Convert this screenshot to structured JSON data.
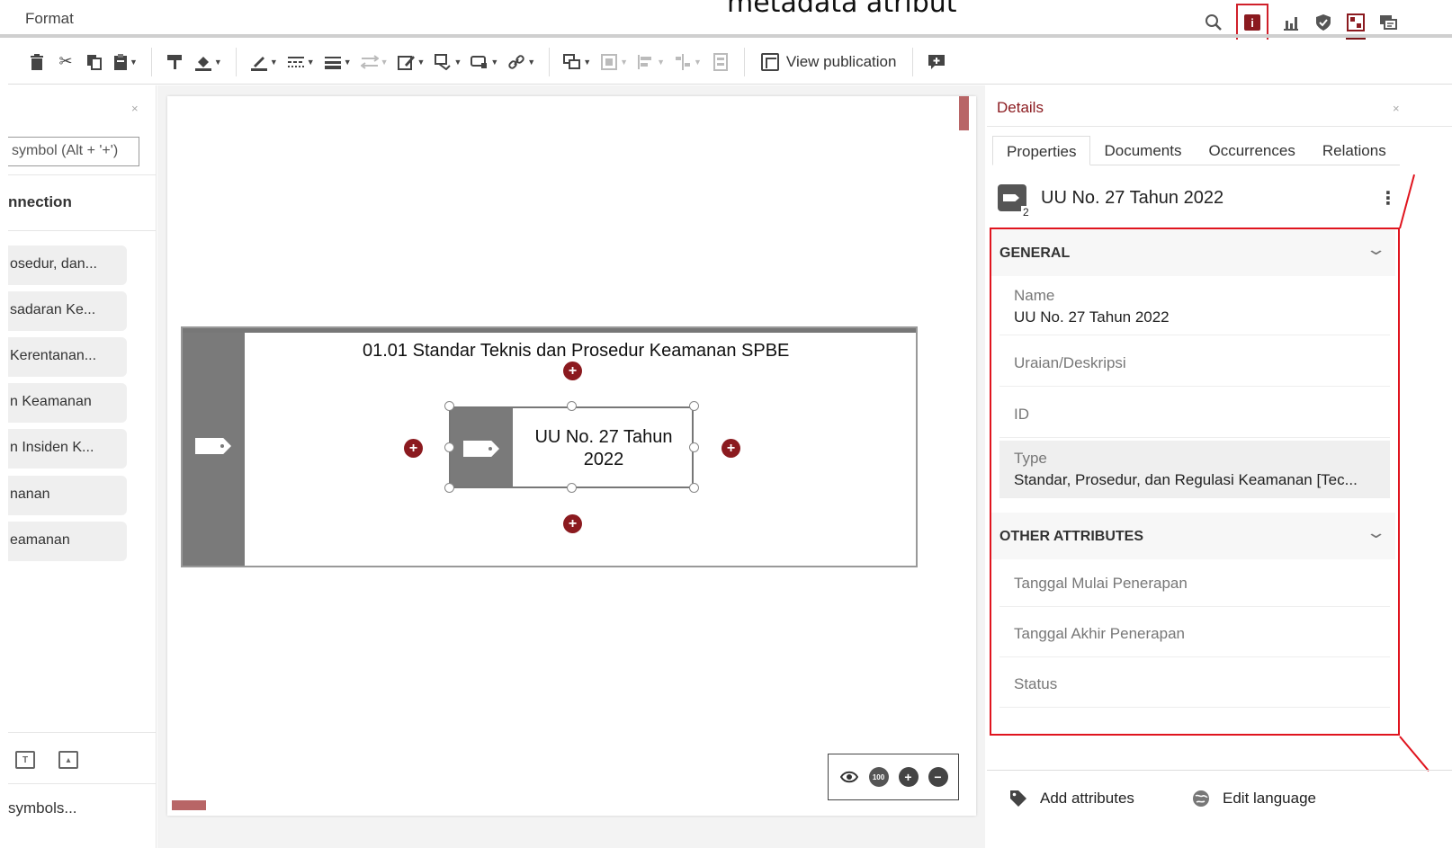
{
  "header": {
    "menu_format": "Format",
    "overlay_caption": "metadata atribut",
    "icons": [
      "search-icon",
      "info-icon",
      "bar-chart-icon",
      "shield-icon",
      "dashboard-icon",
      "chat-icon"
    ]
  },
  "toolbar": {
    "view_publication_label": "View publication"
  },
  "left_panel": {
    "close": "×",
    "search_placeholder": "symbol (Alt + '+')",
    "section_title": "nnection",
    "items": [
      "osedur, dan...",
      "sadaran Ke...",
      "Kerentanan...",
      "n Keamanan",
      "n Insiden K...",
      "nanan",
      "eamanan"
    ],
    "more_symbols": "symbols..."
  },
  "canvas": {
    "container_title": "01.01 Standar Teknis dan Prosedur Keamanan SPBE",
    "node_label": "UU No. 27 Tahun 2022",
    "zoom_100_label": "100",
    "accent_color": "#8b1a1f"
  },
  "details": {
    "title": "Details",
    "close": "×",
    "tabs": [
      "Properties",
      "Documents",
      "Occurrences",
      "Relations"
    ],
    "object_name": "UU No. 27 Tahun 2022",
    "object_count": "2",
    "general": {
      "title": "GENERAL",
      "name_label": "Name",
      "name_value": "UU No. 27 Tahun 2022",
      "description_label": "Uraian/Deskripsi",
      "id_label": "ID",
      "type_label": "Type",
      "type_value": "Standar, Prosedur, dan Regulasi Keamanan [Tec..."
    },
    "other": {
      "title": "OTHER ATTRIBUTES",
      "fields": [
        "Tanggal Mulai Penerapan",
        "Tanggal Akhir Penerapan",
        "Status"
      ]
    },
    "actions": {
      "add_attributes": "Add attributes",
      "edit_language": "Edit language"
    },
    "highlight_color": "#e0141e"
  }
}
